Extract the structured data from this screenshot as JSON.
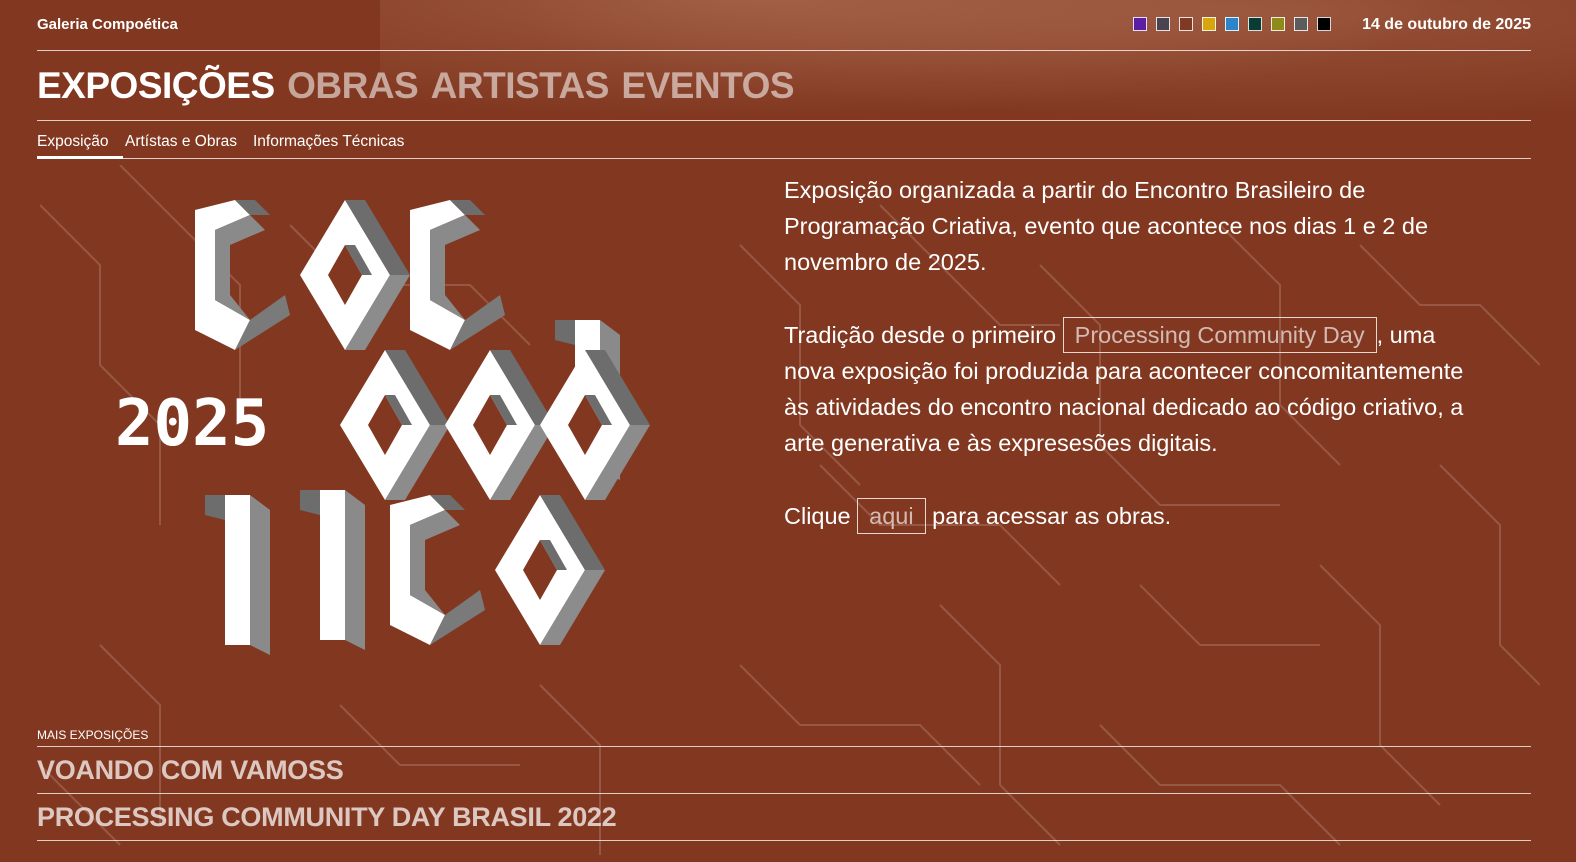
{
  "header": {
    "site_name": "Galeria Compoética",
    "date": "14 de outubro de 2025",
    "swatches": [
      "#5b1fa6",
      "#4a4450",
      "#7e3a22",
      "#d9a50e",
      "#2a86c9",
      "#0b3b35",
      "#8f8a1c",
      "#5c5c5c",
      "#000000"
    ]
  },
  "main_nav": {
    "items": [
      {
        "label": "EXPOSIÇÕES",
        "active": true
      },
      {
        "label": "OBRAS",
        "active": false
      },
      {
        "label": "ARTISTAS",
        "active": false
      },
      {
        "label": "EVENTOS",
        "active": false
      }
    ]
  },
  "sub_nav": {
    "items": [
      "Exposição",
      "Artístas e Obras",
      "Informações Técnicas"
    ],
    "active_index": 0
  },
  "logo": {
    "year": "2025"
  },
  "content": {
    "p1": "Exposição organizada a partir do Encontro Brasileiro de Programação Criativa, evento que acontece nos dias 1 e 2 de novembro de 2025.",
    "p2_before": "Tradição desde o primeiro",
    "p2_link": "Processing Community Day",
    "p2_after": ", uma nova exposição foi produzida para acontecer concomitantemente às atividades do encontro nacional dedicado ao código criativo, a arte generativa e às expresesões digitais.",
    "p3_before": "Clique",
    "p3_link": "aqui",
    "p3_after": "para acessar as obras."
  },
  "more": {
    "title": "MAIS EXPOSIÇÕES",
    "items": [
      "VOANDO COM VAMOSS",
      "PROCESSING COMMUNITY DAY BRASIL 2022"
    ]
  }
}
